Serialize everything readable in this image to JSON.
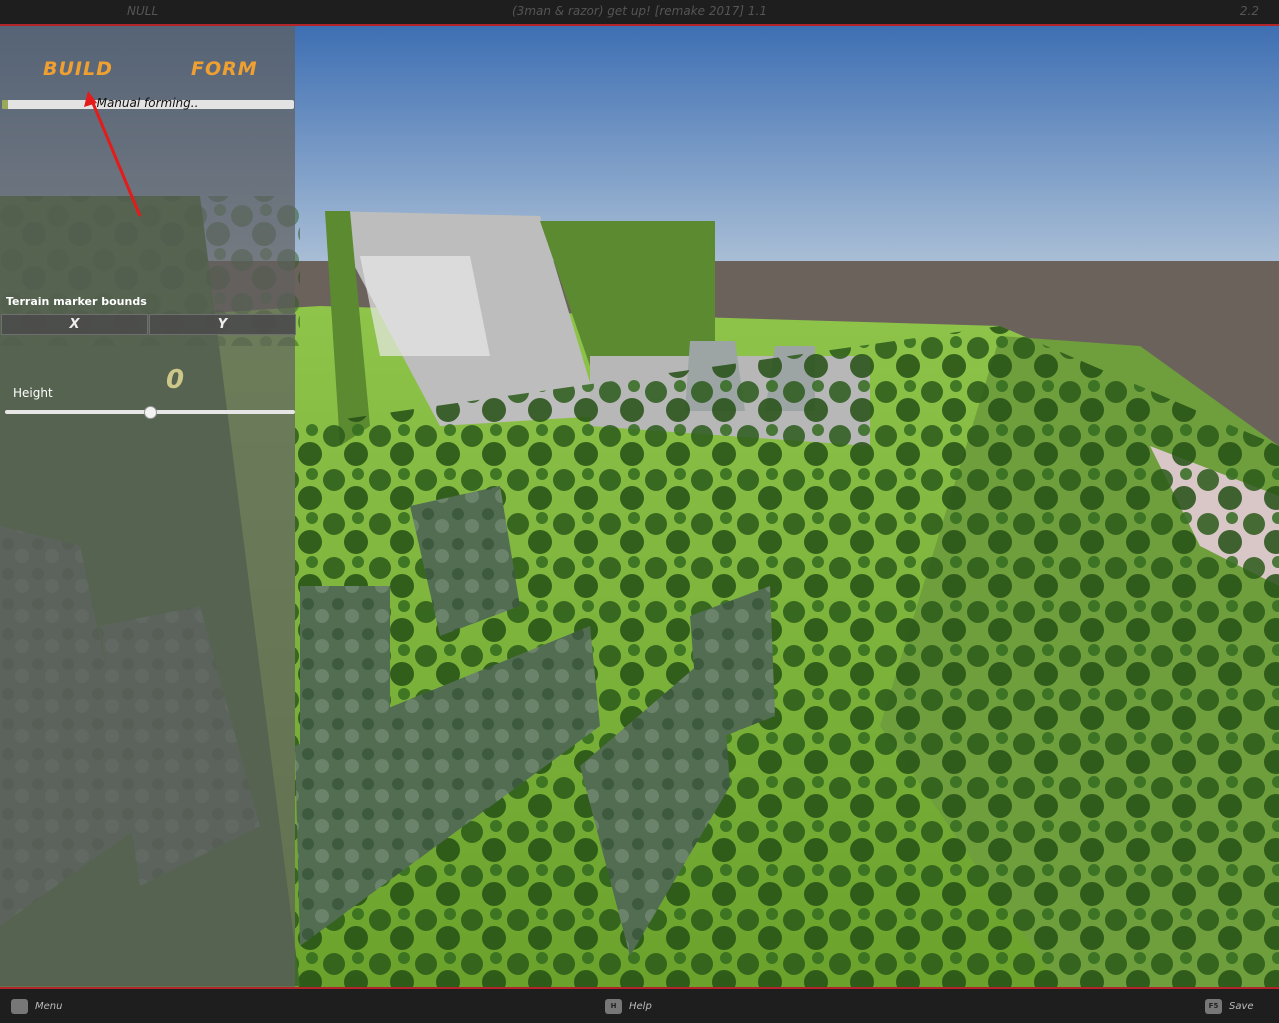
{
  "window": {
    "left_text": "NULL",
    "title": "(3man & razor) get up! [remake 2017] 1.1",
    "version": "2.2"
  },
  "panel": {
    "build_label": "BUILD",
    "form_label": "FORM",
    "progress_label": "Manual forming..",
    "progress": 0.02,
    "bounds_label": "Terrain marker bounds",
    "x_label": "X",
    "y_label": "Y",
    "height_label": "Height",
    "height_value": "0",
    "height_slider": 0.5
  },
  "bottom": {
    "menu_label": "Menu",
    "menu_key": "",
    "help_label": "Help",
    "help_key": "H",
    "save_label": "Save",
    "save_key": "F5"
  },
  "colors": {
    "accent_orange": "#f0a030",
    "bar_red": "#b3252a",
    "sky": "#6f97c9",
    "grass": "#7fb83c",
    "tree": "#2d5a1c"
  }
}
